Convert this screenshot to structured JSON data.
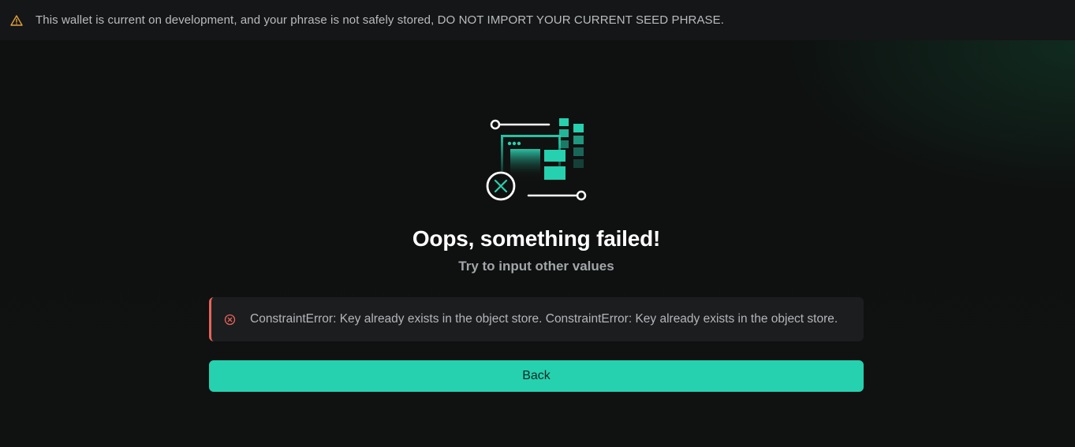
{
  "warning_banner": {
    "icon": "warning-triangle-icon",
    "text": "This wallet is current on development, and your phrase is not safely stored, DO NOT IMPORT YOUR CURRENT SEED PHRASE.",
    "color": "#e2a23b"
  },
  "error_page": {
    "illustration": "failed-connection-illustration",
    "title": "Oops, something failed!",
    "subtitle": "Try to input other values",
    "error": {
      "icon": "error-circle-x-icon",
      "message": "ConstraintError: Key already exists in the object store. ConstraintError: Key already exists in the object store.",
      "accent_color": "#e8645a"
    },
    "back_button_label": "Back"
  },
  "colors": {
    "accent": "#26d1af",
    "background": "#0f1010",
    "banner_background": "#151617",
    "error_background": "#1c1d1f"
  }
}
